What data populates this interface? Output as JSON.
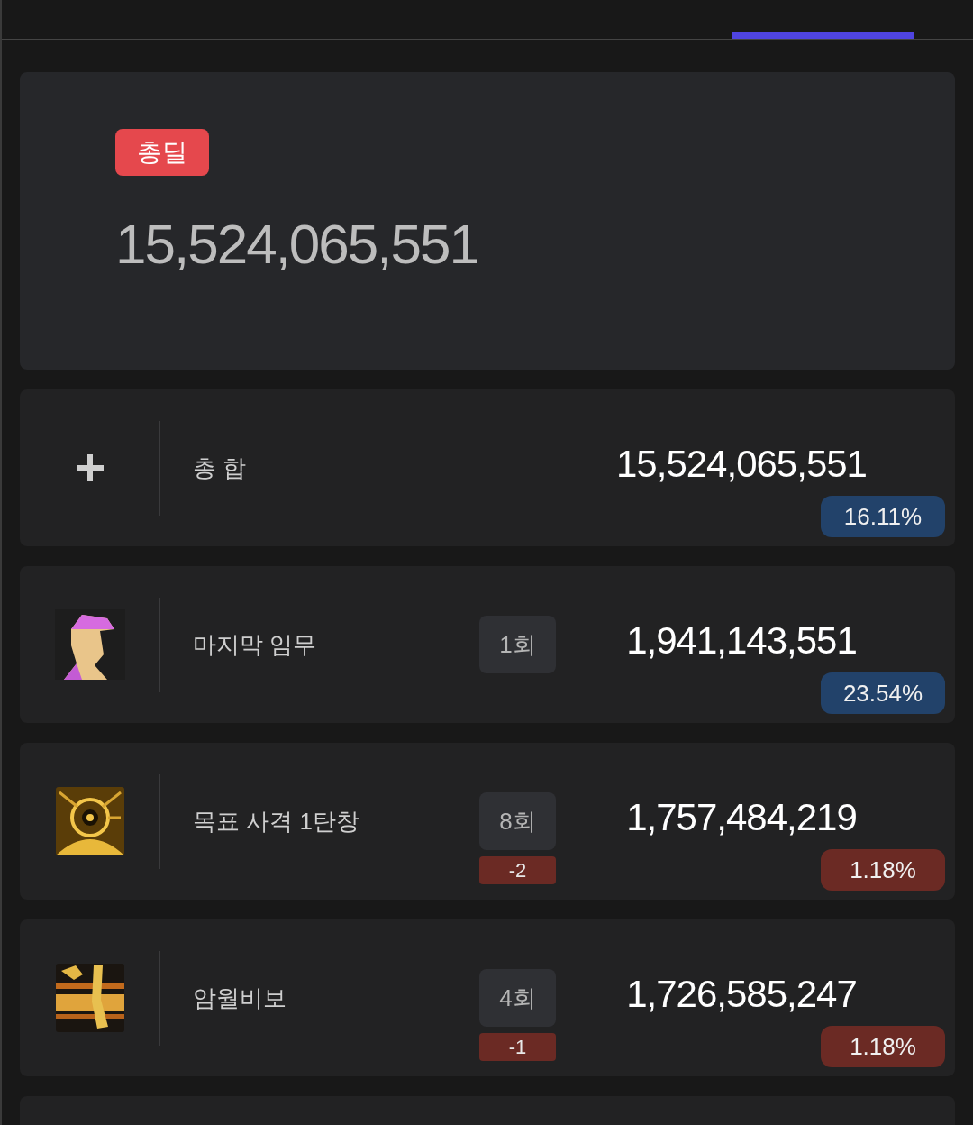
{
  "tabs": [
    {
      "selected": false
    },
    {
      "selected": true
    }
  ],
  "summary": {
    "badge": "총딜",
    "value": "15,524,065,551"
  },
  "rows": [
    {
      "kind": "total",
      "name": "총 합",
      "value": "15,524,065,551",
      "percent": {
        "text": "16.11%",
        "color": "#22426a"
      }
    },
    {
      "kind": "skill",
      "name": "마지막 임무",
      "count": "1회",
      "value": "1,941,143,551",
      "percent": {
        "text": "23.54%",
        "color": "#22426a"
      }
    },
    {
      "kind": "skill",
      "name": "목표 사격 1탄창",
      "count": "8회",
      "diff": "-2",
      "value": "1,757,484,219",
      "percent": {
        "text": "1.18%",
        "color": "#6b2a24"
      }
    },
    {
      "kind": "skill",
      "name": "암월비보",
      "count": "4회",
      "diff": "-1",
      "value": "1,726,585,247",
      "percent": {
        "text": "1.18%",
        "color": "#6b2a24"
      }
    },
    {
      "kind": "empty"
    }
  ]
}
